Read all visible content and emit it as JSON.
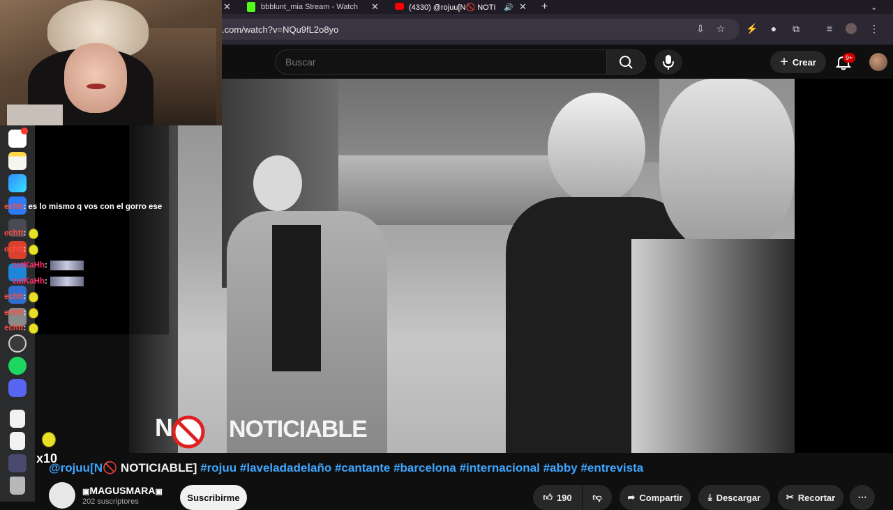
{
  "browser": {
    "tabs": [
      {
        "label": "bbblunt_mia Stream - Watch"
      },
      {
        "label": "(4330) @rojuu[N🚫 NOTI"
      }
    ],
    "url": ".com/watch?v=NQu9fL2o8yo"
  },
  "header": {
    "search_placeholder": "Buscar",
    "create_label": "Crear",
    "notifications_badge": "9+"
  },
  "chat": {
    "lines": [
      {
        "user": "echtt",
        "message": ": es lo mismo q vos con el gorro ese"
      },
      {
        "user": "echtt",
        "message": ":"
      },
      {
        "user": "echtt",
        "message": ":"
      },
      {
        "user": "zatKaHh",
        "message": ":"
      },
      {
        "user": "zatKaHh",
        "message": ":"
      },
      {
        "user": "echtt",
        "message": ":"
      },
      {
        "user": "echtt",
        "message": ":"
      },
      {
        "user": "echtt",
        "message": ":"
      }
    ],
    "multiplier": "x10"
  },
  "video": {
    "watermark_left": "N",
    "watermark_right": "NOTICIABLE"
  },
  "title": {
    "prefix": "@rojuu[N",
    "main": " NOTICIABLE]",
    "hashtags": [
      "#rojuu",
      "#laveladadelaño",
      "#cantante",
      "#barcelona",
      "#internacional",
      "#abby",
      "#entrevista"
    ]
  },
  "channel": {
    "name": "MAGUSMARA",
    "subscribers": "202 suscriptores",
    "subscribe_label": "Suscribirme"
  },
  "actions": {
    "likes": "190",
    "share_label": "Compartir",
    "download_label": "Descargar",
    "clip_label": "Recortar"
  },
  "colors": {
    "hashtag": "#3ea6ff",
    "chat_user": "#ff4d3d",
    "badge": "#cc0000"
  }
}
